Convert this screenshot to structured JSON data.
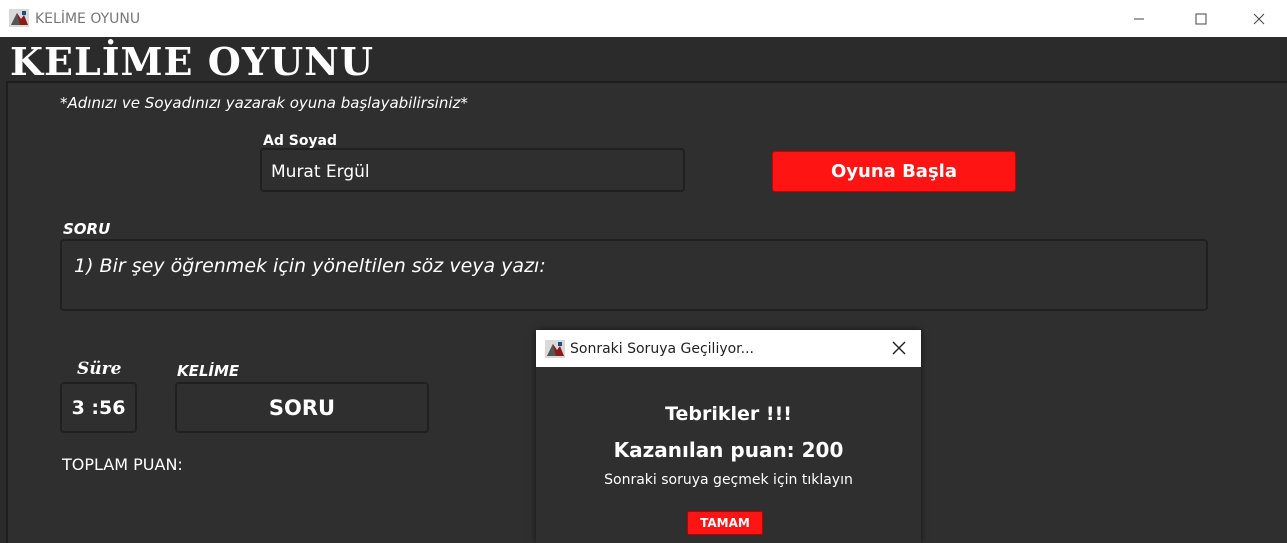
{
  "window": {
    "title": "KELİME OYUNU",
    "icon": "app-game-icon",
    "controls": [
      "minimize-icon",
      "maximize-icon",
      "close-icon"
    ]
  },
  "app": {
    "heading": "KELİME OYUNU",
    "hint": "*Adınızı ve Soyadınızı yazarak oyuna başlayabilirsiniz*"
  },
  "player": {
    "label": "Ad Soyad",
    "value": "Murat Ergül"
  },
  "start_button": {
    "label": "Oyuna Başla",
    "color": "#ff1414"
  },
  "question": {
    "label": "SORU",
    "text": "1) Bir şey öğrenmek için yöneltilen söz veya yazı:"
  },
  "timer": {
    "label": "Süre",
    "value": "3 :56"
  },
  "word": {
    "label": "KELİME",
    "value": "SORU"
  },
  "score": {
    "label": "TOPLAM PUAN:"
  },
  "dialog": {
    "title": "Sonraki Soruya Geçiliyor...",
    "congrats": "Tebrikler !!!",
    "points": "Kazanılan puan: 200",
    "instruction": "Sonraki soruya geçmek için tıklayın",
    "ok_label": "TAMAM"
  }
}
